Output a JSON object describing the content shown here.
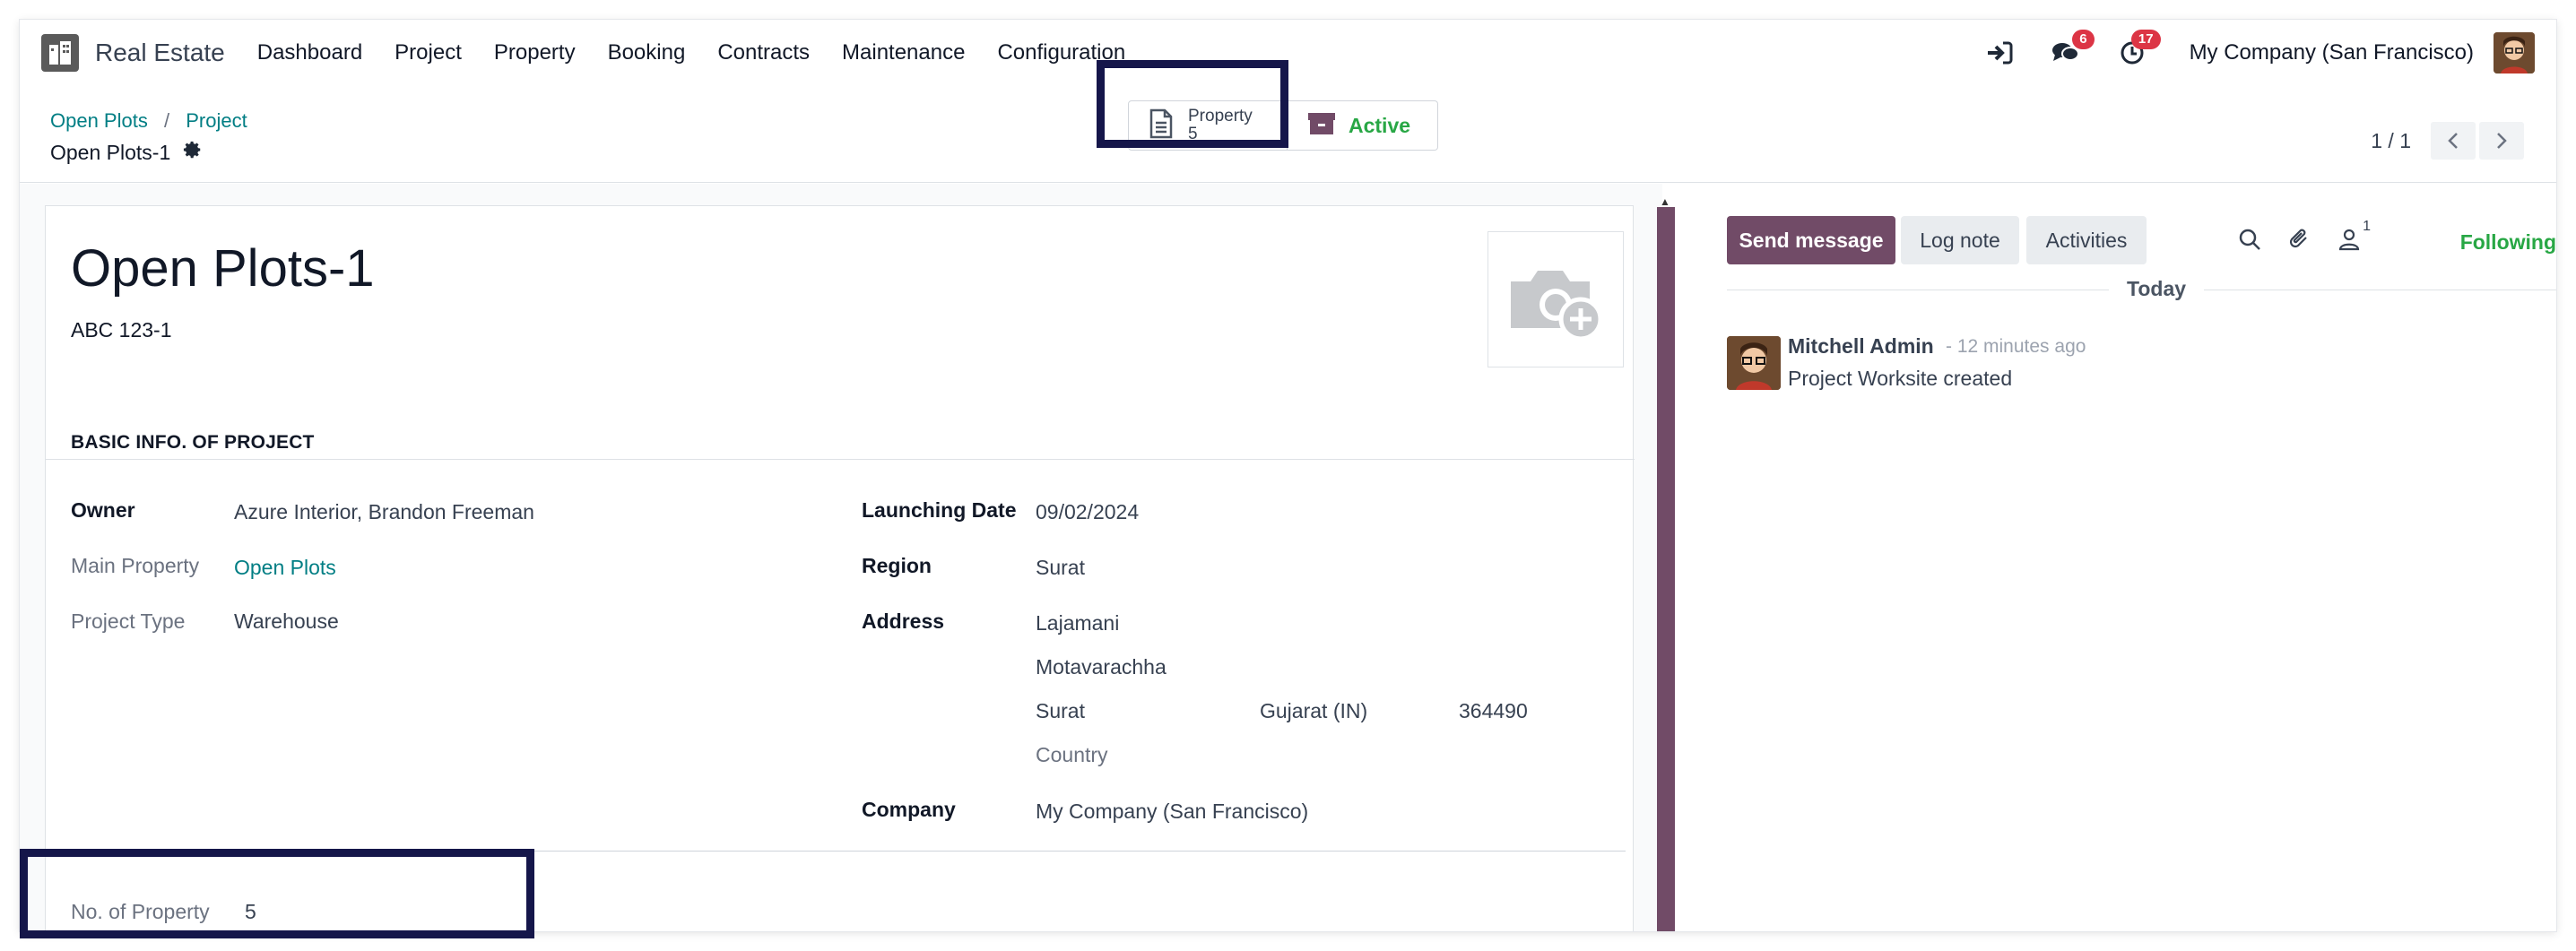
{
  "navbar": {
    "app_name": "Real Estate",
    "menu": [
      "Dashboard",
      "Project",
      "Property",
      "Booking",
      "Contracts",
      "Maintenance",
      "Configuration"
    ],
    "messages_badge": "6",
    "activities_badge": "17",
    "company": "My Company (San Francisco)"
  },
  "breadcrumb": {
    "items": [
      "Open Plots",
      "Project"
    ],
    "current": "Open Plots-1"
  },
  "smart_buttons": {
    "property_label": "Property",
    "property_count": "5",
    "active_label": "Active"
  },
  "pager": {
    "value": "1 / 1"
  },
  "form": {
    "name": "Open Plots-1",
    "code": "ABC 123-1",
    "section_title": "BASIC INFO. OF PROJECT",
    "owner_label": "Owner",
    "owner_value": "Azure Interior, Brandon Freeman",
    "main_property_label": "Main Property",
    "main_property_value": "Open Plots",
    "project_type_label": "Project Type",
    "project_type_value": "Warehouse",
    "launching_date_label": "Launching Date",
    "launching_date_value": "09/02/2024",
    "region_label": "Region",
    "region_value": "Surat",
    "address_label": "Address",
    "address": {
      "street": "Lajamani",
      "street2": "Motavarachha",
      "city": "Surat",
      "state": "Gujarat (IN)",
      "zip": "364490",
      "country_placeholder": "Country"
    },
    "company_label": "Company",
    "company_value": "My Company (San Francisco)",
    "no_of_property_label": "No. of Property",
    "no_of_property_value": "5"
  },
  "chatter": {
    "send_message": "Send message",
    "log_note": "Log note",
    "activities": "Activities",
    "followers_count": "1",
    "following": "Following",
    "date_separator": "Today",
    "messages": [
      {
        "author": "Mitchell Admin",
        "time": "- 12 minutes ago",
        "body": "Project Worksite created"
      }
    ]
  },
  "colors": {
    "brand": "#714b67",
    "link": "#017e84",
    "success": "#28a745",
    "badge": "#dc3545",
    "highlight_box": "#15164a"
  },
  "icons": [
    "app-logo-icon",
    "sign-in-icon",
    "messages-icon",
    "clock-icon",
    "gear-icon",
    "document-icon",
    "archive-icon",
    "chevron-left-icon",
    "chevron-right-icon",
    "camera-plus-icon",
    "search-icon",
    "paperclip-icon",
    "follower-icon"
  ]
}
